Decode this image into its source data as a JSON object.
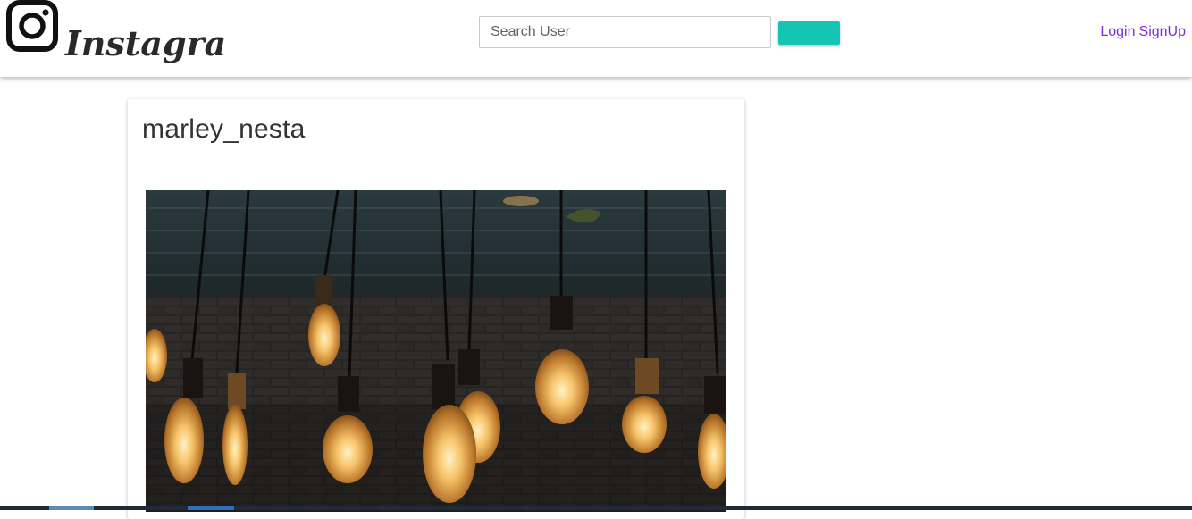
{
  "header": {
    "brand": "Instagram",
    "search": {
      "placeholder": "Search User",
      "value": ""
    },
    "search_button_label": "",
    "nav_links": [
      "Login",
      "SignUp"
    ],
    "accent_color": "#14c5b4",
    "link_color": "#7b2ee0"
  },
  "post": {
    "username": "marley_nesta"
  }
}
